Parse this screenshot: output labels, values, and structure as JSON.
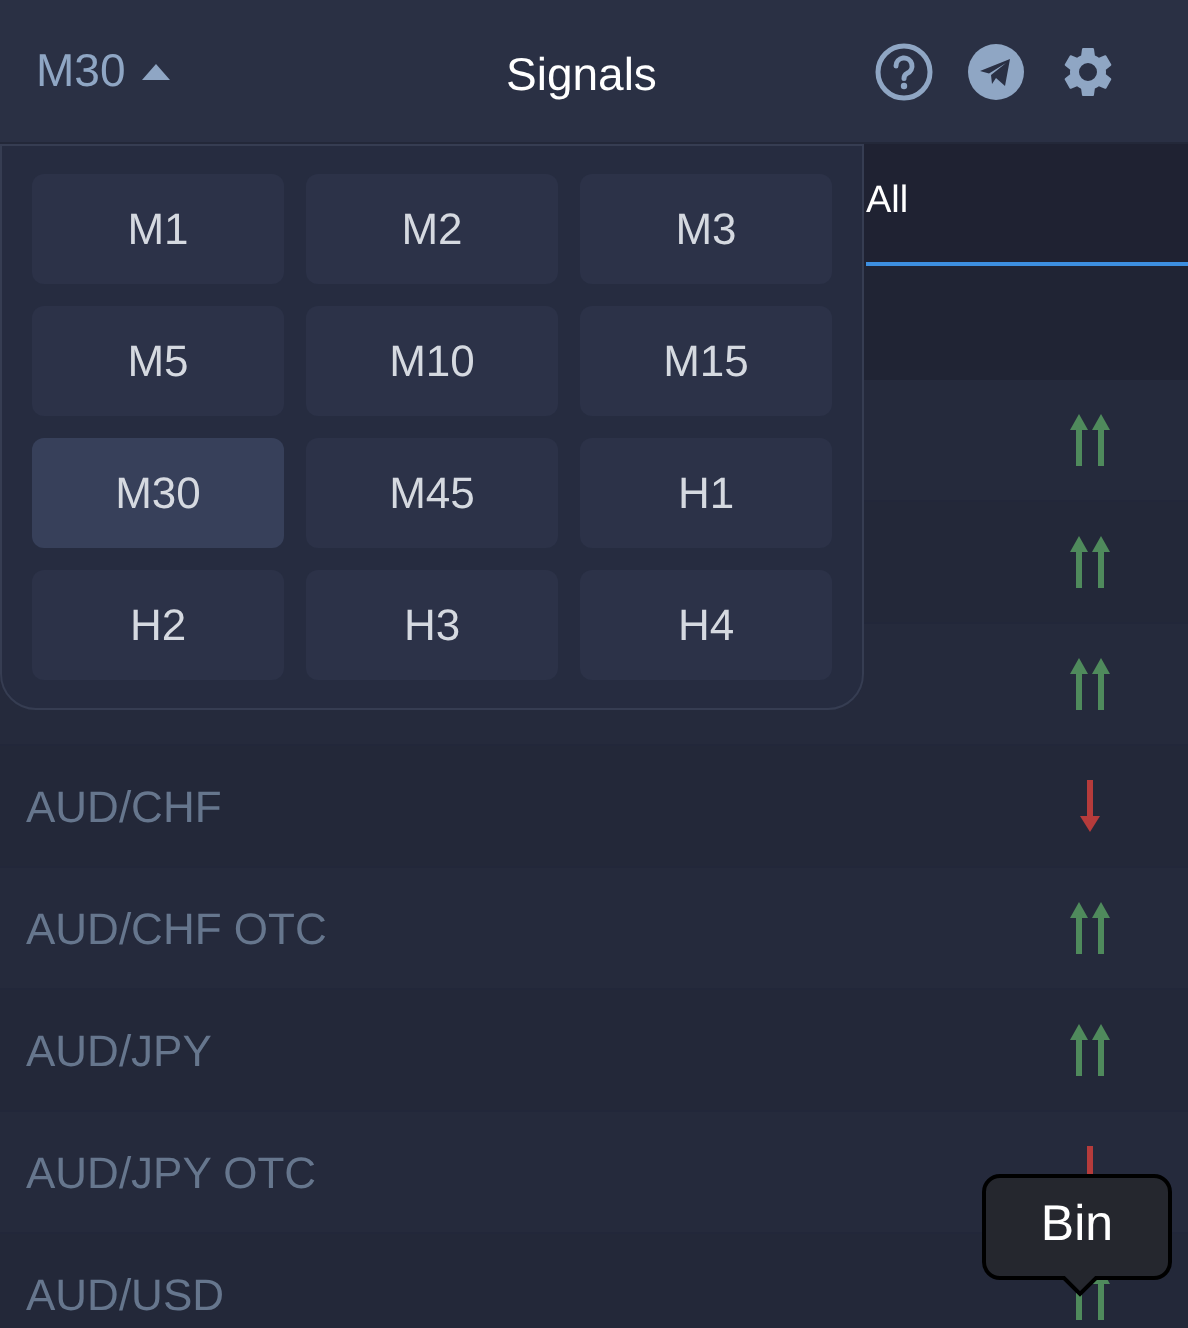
{
  "header": {
    "timeframe": "M30",
    "title": "Signals"
  },
  "tabs": [
    {
      "label": "All",
      "selected": true
    }
  ],
  "timeframe_menu": {
    "open": true,
    "options": [
      {
        "label": "M1",
        "selected": false
      },
      {
        "label": "M2",
        "selected": false
      },
      {
        "label": "M3",
        "selected": false
      },
      {
        "label": "M5",
        "selected": false
      },
      {
        "label": "M10",
        "selected": false
      },
      {
        "label": "M15",
        "selected": false
      },
      {
        "label": "M30",
        "selected": true
      },
      {
        "label": "M45",
        "selected": false
      },
      {
        "label": "H1",
        "selected": false
      },
      {
        "label": "H2",
        "selected": false
      },
      {
        "label": "H3",
        "selected": false
      },
      {
        "label": "H4",
        "selected": false
      }
    ]
  },
  "rows": [
    {
      "kind": "strong_up"
    },
    {
      "kind": "strong_up"
    },
    {
      "kind": "strong_up"
    },
    {
      "name": "AUD/CHF",
      "kind": "down"
    },
    {
      "name": "AUD/CHF OTC",
      "kind": "strong_up"
    },
    {
      "name": "AUD/JPY",
      "kind": "strong_up"
    },
    {
      "name": "AUD/JPY OTC",
      "kind": "down"
    },
    {
      "name": "AUD/USD",
      "kind": "strong_up"
    }
  ],
  "tooltip": {
    "text": "Bin"
  }
}
